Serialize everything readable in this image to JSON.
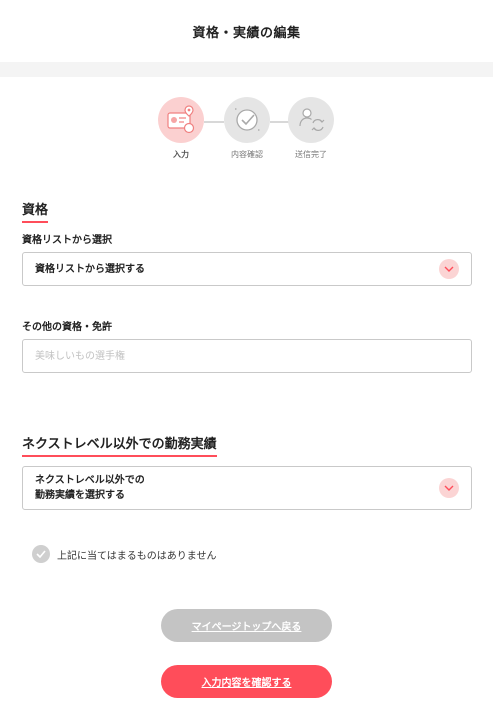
{
  "header": {
    "title": "資格・実績の編集"
  },
  "steps": [
    {
      "label": "入力",
      "state": "active",
      "icon": "id-card-icon"
    },
    {
      "label": "内容確認",
      "state": "inactive",
      "icon": "check-badge-icon"
    },
    {
      "label": "送信完了",
      "state": "inactive",
      "icon": "send-cycle-icon"
    }
  ],
  "qualification": {
    "title": "資格",
    "list_label": "資格リストから選択",
    "list_select_value": "資格リストから選択する",
    "other_label": "その他の資格・免許",
    "other_placeholder": "美味しいもの選手権"
  },
  "experience": {
    "title": "ネクストレベル以外での勤務実績",
    "select_line1": "ネクストレベル以外での",
    "select_line2": "勤務実績を選択する",
    "none_label": "上記に当てはまるものはありません"
  },
  "buttons": {
    "mypage": "マイページトップへ戻る",
    "confirm": "入力内容を確認する"
  },
  "colors": {
    "accent": "#ff4d5a",
    "accent_light": "#fbd0d0",
    "disabled": "#c4c4c4"
  }
}
